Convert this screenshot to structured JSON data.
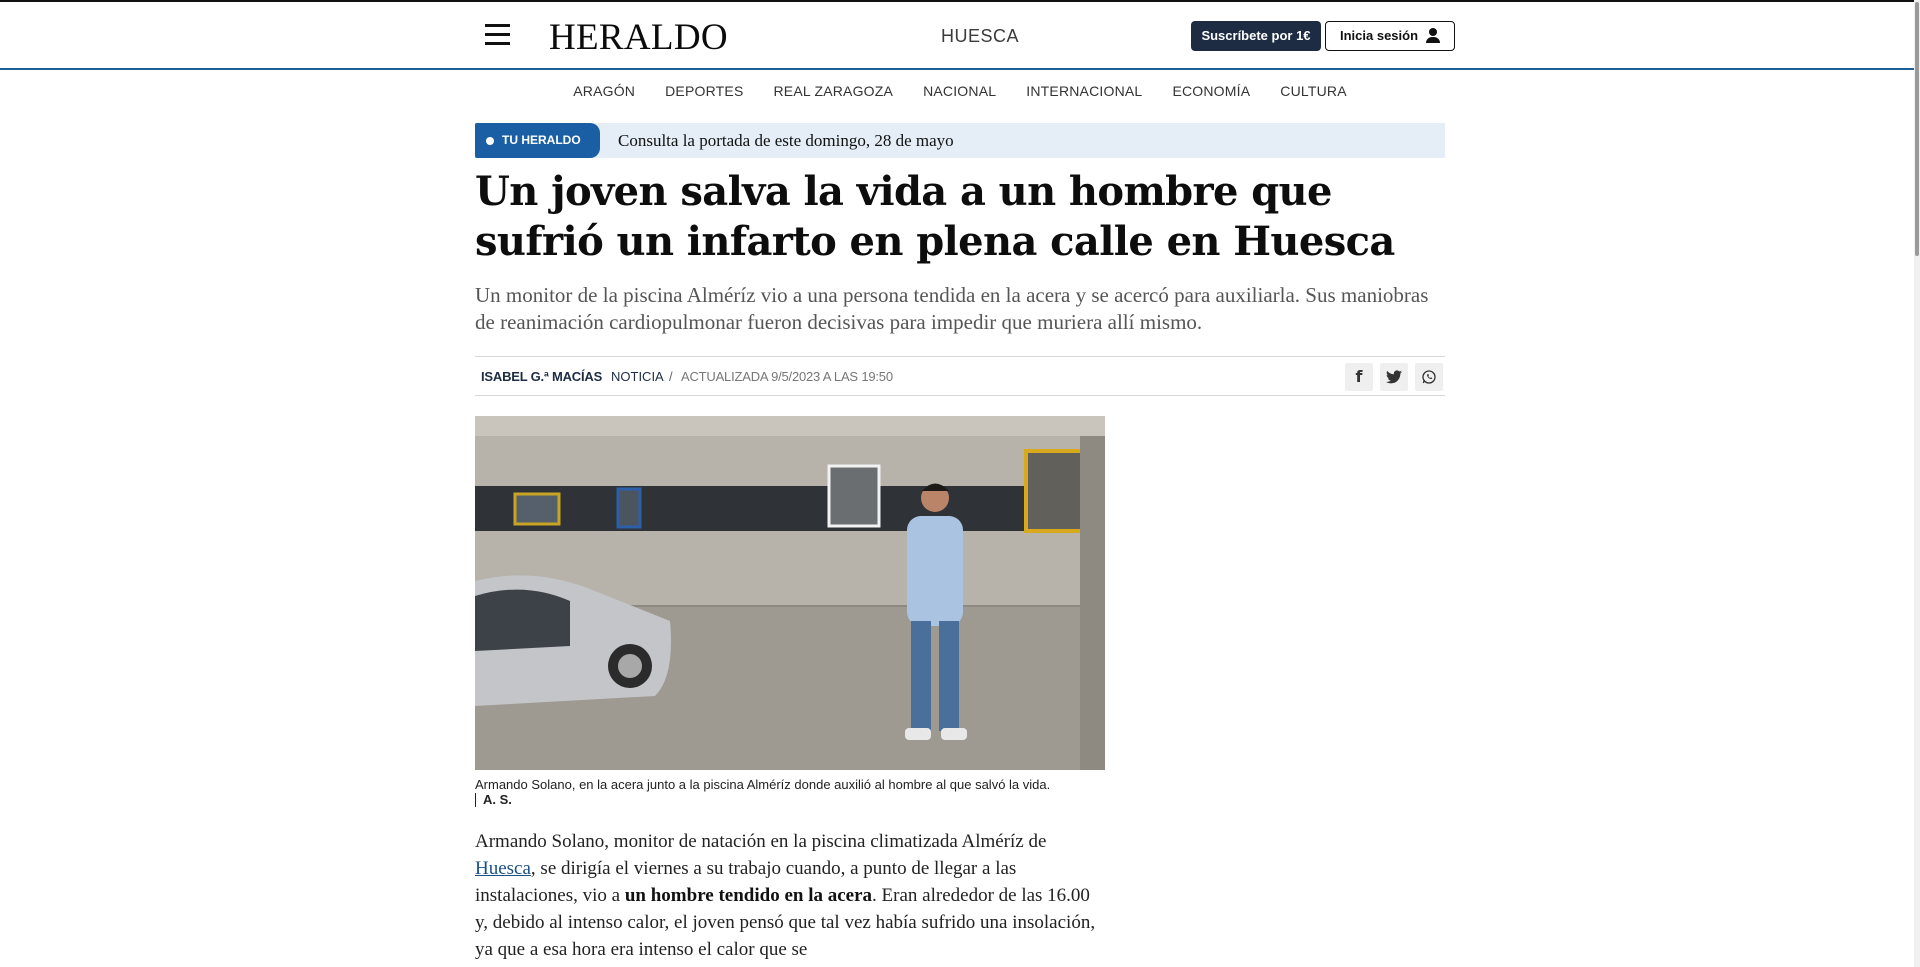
{
  "header": {
    "logo": "HERALDO",
    "section": "HUESCA",
    "subscribe_label": "Suscríbete por 1€",
    "login_label": "Inicia sesión"
  },
  "nav": {
    "items": [
      "ARAGÓN",
      "DEPORTES",
      "REAL ZARAGOZA",
      "NACIONAL",
      "INTERNACIONAL",
      "ECONOMÍA",
      "CULTURA"
    ]
  },
  "banner": {
    "tag": "TU HERALDO",
    "text": "Consulta la portada de este domingo, 28 de mayo"
  },
  "article": {
    "headline": "Un joven salva la vida a un hombre que sufrió un infarto en plena calle en Huesca",
    "subhead": "Un monitor de la piscina Alméríz vio a una persona tendida en la acera y se acercó para auxiliarla. Sus maniobras de reanimación cardiopulmonar fueron decisivas para impedir que muriera allí mismo.",
    "author": "ISABEL G.ª MACÍAS",
    "type": "NOTICIA",
    "separator": "/",
    "updated": "ACTUALIZADA 9/5/2023 A LAS 19:50",
    "caption": "Armando Solano, en la acera junto a la piscina Alméríz donde auxilió al hombre al que salvó la vida.",
    "credit": "A. S.",
    "body": {
      "p1_a": "Armando Solano, monitor de natación en la piscina climatizada Alméríz de ",
      "p1_link": "Huesca",
      "p1_b": ", se dirigía el viernes a su trabajo cuando, a punto de llegar a las instalaciones, vio a ",
      "p1_bold": "un hombre tendido en la acera",
      "p1_c": ". Eran alrededor de las 16.00 y, debido al intenso calor, el joven pensó que tal vez había sufrido una insolación, ya que a esa hora era intenso el calor que se"
    }
  },
  "share": {
    "facebook": "f",
    "twitter": "t",
    "whatsapp": "w"
  },
  "colors": {
    "brand_dark": "#1d2c42",
    "accent_blue": "#1a5fa3",
    "banner_bg": "#e5eef6"
  }
}
